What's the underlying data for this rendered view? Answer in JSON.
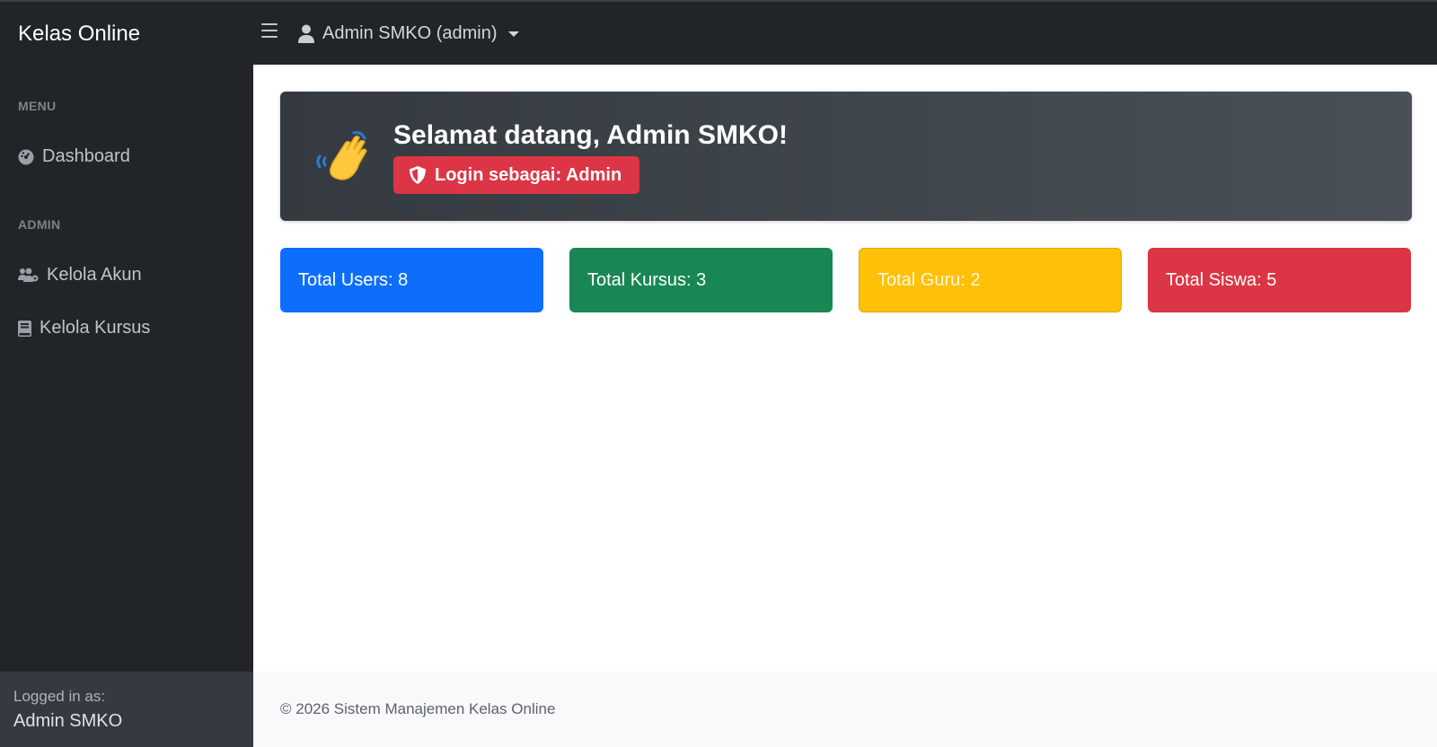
{
  "app": {
    "brand": "Kelas Online"
  },
  "topbar": {
    "user_label": "Admin SMKO (admin)"
  },
  "sidebar": {
    "sections": [
      {
        "heading": "MENU",
        "items": [
          {
            "label": "Dashboard",
            "icon": "dashboard-gauge-icon"
          }
        ]
      },
      {
        "heading": "ADMIN",
        "items": [
          {
            "label": "Kelola Akun",
            "icon": "users-cog-icon"
          },
          {
            "label": "Kelola Kursus",
            "icon": "book-icon"
          }
        ]
      }
    ],
    "footer": {
      "label": "Logged in as:",
      "name": "Admin SMKO"
    }
  },
  "welcome": {
    "title": "Selamat datang, Admin SMKO!",
    "badge": "Login sebagai: Admin",
    "emoji": "waving-hand-icon"
  },
  "stats": [
    {
      "label": "Total Users: 8",
      "color": "#0d6efd"
    },
    {
      "label": "Total Kursus: 3",
      "color": "#198754"
    },
    {
      "label": "Total Guru: 2",
      "color": "#ffc107"
    },
    {
      "label": "Total Siswa: 5",
      "color": "#dc3545"
    }
  ],
  "footer": {
    "text": "© 2026 Sistem Manajemen Kelas Online"
  },
  "colors": {
    "dark": "#212529",
    "danger": "#dc3545",
    "primary": "#0d6efd",
    "success": "#198754",
    "warning": "#ffc107"
  }
}
